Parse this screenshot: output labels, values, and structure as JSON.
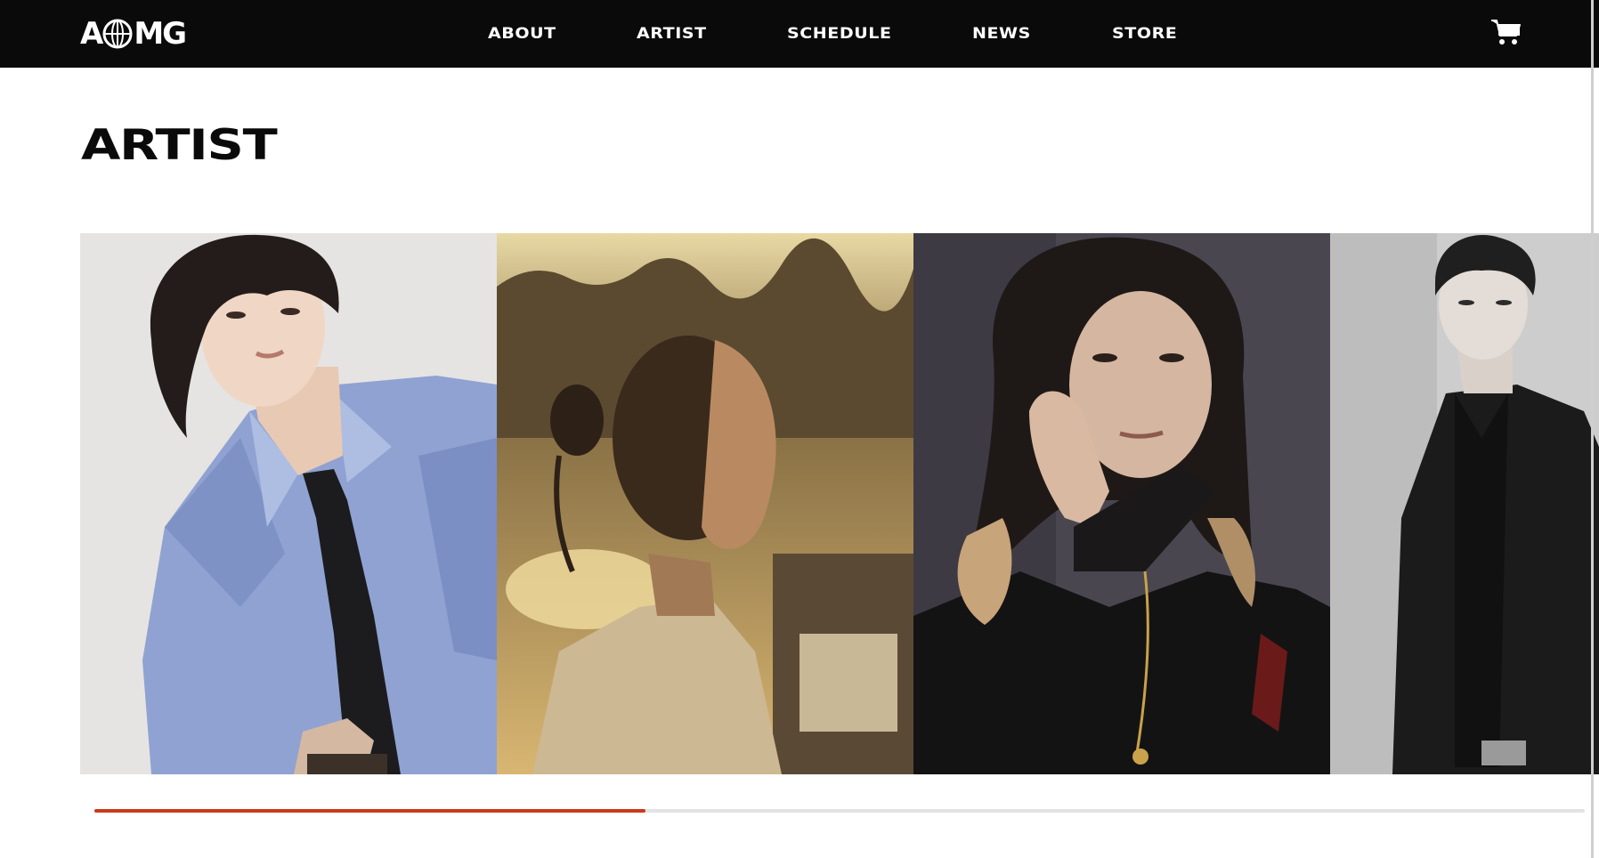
{
  "header": {
    "logo_text": "A MG",
    "nav": [
      {
        "label": "ABOUT"
      },
      {
        "label": "ARTIST"
      },
      {
        "label": "SCHEDULE"
      },
      {
        "label": "NEWS"
      },
      {
        "label": "STORE"
      }
    ],
    "cart_icon": "shopping-cart-icon"
  },
  "page": {
    "title": "ARTIST"
  },
  "carousel": {
    "cards": [
      {
        "icon": "artist-photo-blue-shirt"
      },
      {
        "icon": "artist-photo-sunset"
      },
      {
        "icon": "artist-photo-dark-knit"
      },
      {
        "icon": "artist-photo-black-suit"
      }
    ],
    "progress": 0.37
  },
  "colors": {
    "header_bg": "#0b0a0a",
    "accent": "#cc3a1a",
    "track": "#e3e3e3"
  }
}
